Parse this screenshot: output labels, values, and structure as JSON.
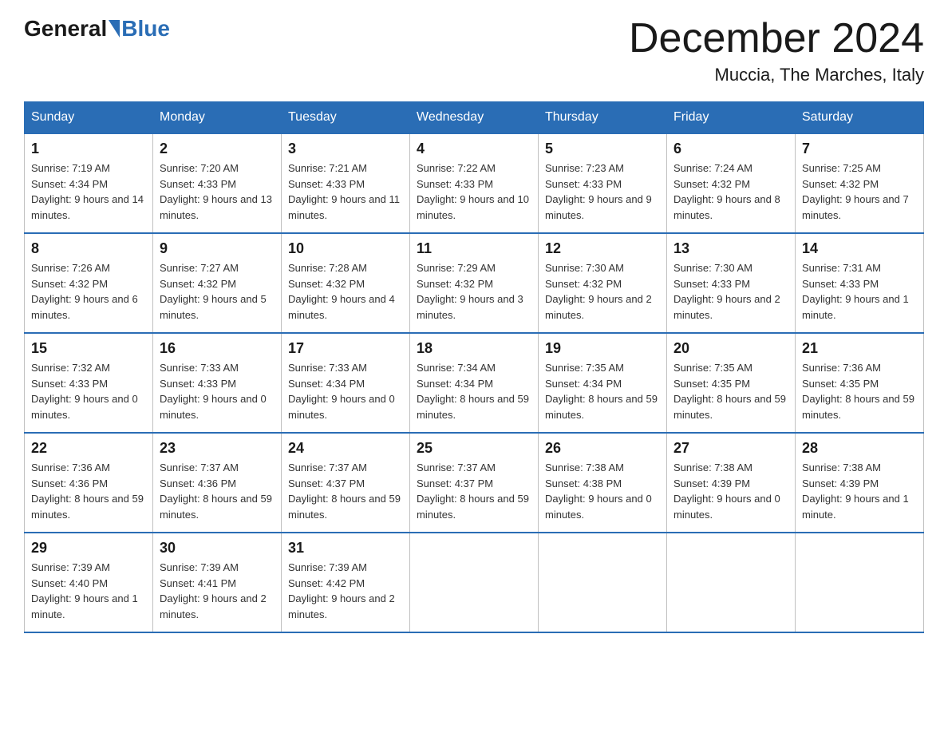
{
  "header": {
    "logo_general": "General",
    "logo_blue": "Blue",
    "month_title": "December 2024",
    "location": "Muccia, The Marches, Italy"
  },
  "weekdays": [
    "Sunday",
    "Monday",
    "Tuesday",
    "Wednesday",
    "Thursday",
    "Friday",
    "Saturday"
  ],
  "weeks": [
    [
      {
        "day": "1",
        "sunrise": "7:19 AM",
        "sunset": "4:34 PM",
        "daylight": "9 hours and 14 minutes."
      },
      {
        "day": "2",
        "sunrise": "7:20 AM",
        "sunset": "4:33 PM",
        "daylight": "9 hours and 13 minutes."
      },
      {
        "day": "3",
        "sunrise": "7:21 AM",
        "sunset": "4:33 PM",
        "daylight": "9 hours and 11 minutes."
      },
      {
        "day": "4",
        "sunrise": "7:22 AM",
        "sunset": "4:33 PM",
        "daylight": "9 hours and 10 minutes."
      },
      {
        "day": "5",
        "sunrise": "7:23 AM",
        "sunset": "4:33 PM",
        "daylight": "9 hours and 9 minutes."
      },
      {
        "day": "6",
        "sunrise": "7:24 AM",
        "sunset": "4:32 PM",
        "daylight": "9 hours and 8 minutes."
      },
      {
        "day": "7",
        "sunrise": "7:25 AM",
        "sunset": "4:32 PM",
        "daylight": "9 hours and 7 minutes."
      }
    ],
    [
      {
        "day": "8",
        "sunrise": "7:26 AM",
        "sunset": "4:32 PM",
        "daylight": "9 hours and 6 minutes."
      },
      {
        "day": "9",
        "sunrise": "7:27 AM",
        "sunset": "4:32 PM",
        "daylight": "9 hours and 5 minutes."
      },
      {
        "day": "10",
        "sunrise": "7:28 AM",
        "sunset": "4:32 PM",
        "daylight": "9 hours and 4 minutes."
      },
      {
        "day": "11",
        "sunrise": "7:29 AM",
        "sunset": "4:32 PM",
        "daylight": "9 hours and 3 minutes."
      },
      {
        "day": "12",
        "sunrise": "7:30 AM",
        "sunset": "4:32 PM",
        "daylight": "9 hours and 2 minutes."
      },
      {
        "day": "13",
        "sunrise": "7:30 AM",
        "sunset": "4:33 PM",
        "daylight": "9 hours and 2 minutes."
      },
      {
        "day": "14",
        "sunrise": "7:31 AM",
        "sunset": "4:33 PM",
        "daylight": "9 hours and 1 minute."
      }
    ],
    [
      {
        "day": "15",
        "sunrise": "7:32 AM",
        "sunset": "4:33 PM",
        "daylight": "9 hours and 0 minutes."
      },
      {
        "day": "16",
        "sunrise": "7:33 AM",
        "sunset": "4:33 PM",
        "daylight": "9 hours and 0 minutes."
      },
      {
        "day": "17",
        "sunrise": "7:33 AM",
        "sunset": "4:34 PM",
        "daylight": "9 hours and 0 minutes."
      },
      {
        "day": "18",
        "sunrise": "7:34 AM",
        "sunset": "4:34 PM",
        "daylight": "8 hours and 59 minutes."
      },
      {
        "day": "19",
        "sunrise": "7:35 AM",
        "sunset": "4:34 PM",
        "daylight": "8 hours and 59 minutes."
      },
      {
        "day": "20",
        "sunrise": "7:35 AM",
        "sunset": "4:35 PM",
        "daylight": "8 hours and 59 minutes."
      },
      {
        "day": "21",
        "sunrise": "7:36 AM",
        "sunset": "4:35 PM",
        "daylight": "8 hours and 59 minutes."
      }
    ],
    [
      {
        "day": "22",
        "sunrise": "7:36 AM",
        "sunset": "4:36 PM",
        "daylight": "8 hours and 59 minutes."
      },
      {
        "day": "23",
        "sunrise": "7:37 AM",
        "sunset": "4:36 PM",
        "daylight": "8 hours and 59 minutes."
      },
      {
        "day": "24",
        "sunrise": "7:37 AM",
        "sunset": "4:37 PM",
        "daylight": "8 hours and 59 minutes."
      },
      {
        "day": "25",
        "sunrise": "7:37 AM",
        "sunset": "4:37 PM",
        "daylight": "8 hours and 59 minutes."
      },
      {
        "day": "26",
        "sunrise": "7:38 AM",
        "sunset": "4:38 PM",
        "daylight": "9 hours and 0 minutes."
      },
      {
        "day": "27",
        "sunrise": "7:38 AM",
        "sunset": "4:39 PM",
        "daylight": "9 hours and 0 minutes."
      },
      {
        "day": "28",
        "sunrise": "7:38 AM",
        "sunset": "4:39 PM",
        "daylight": "9 hours and 1 minute."
      }
    ],
    [
      {
        "day": "29",
        "sunrise": "7:39 AM",
        "sunset": "4:40 PM",
        "daylight": "9 hours and 1 minute."
      },
      {
        "day": "30",
        "sunrise": "7:39 AM",
        "sunset": "4:41 PM",
        "daylight": "9 hours and 2 minutes."
      },
      {
        "day": "31",
        "sunrise": "7:39 AM",
        "sunset": "4:42 PM",
        "daylight": "9 hours and 2 minutes."
      },
      null,
      null,
      null,
      null
    ]
  ],
  "labels": {
    "sunrise_prefix": "Sunrise: ",
    "sunset_prefix": "Sunset: ",
    "daylight_prefix": "Daylight: "
  }
}
